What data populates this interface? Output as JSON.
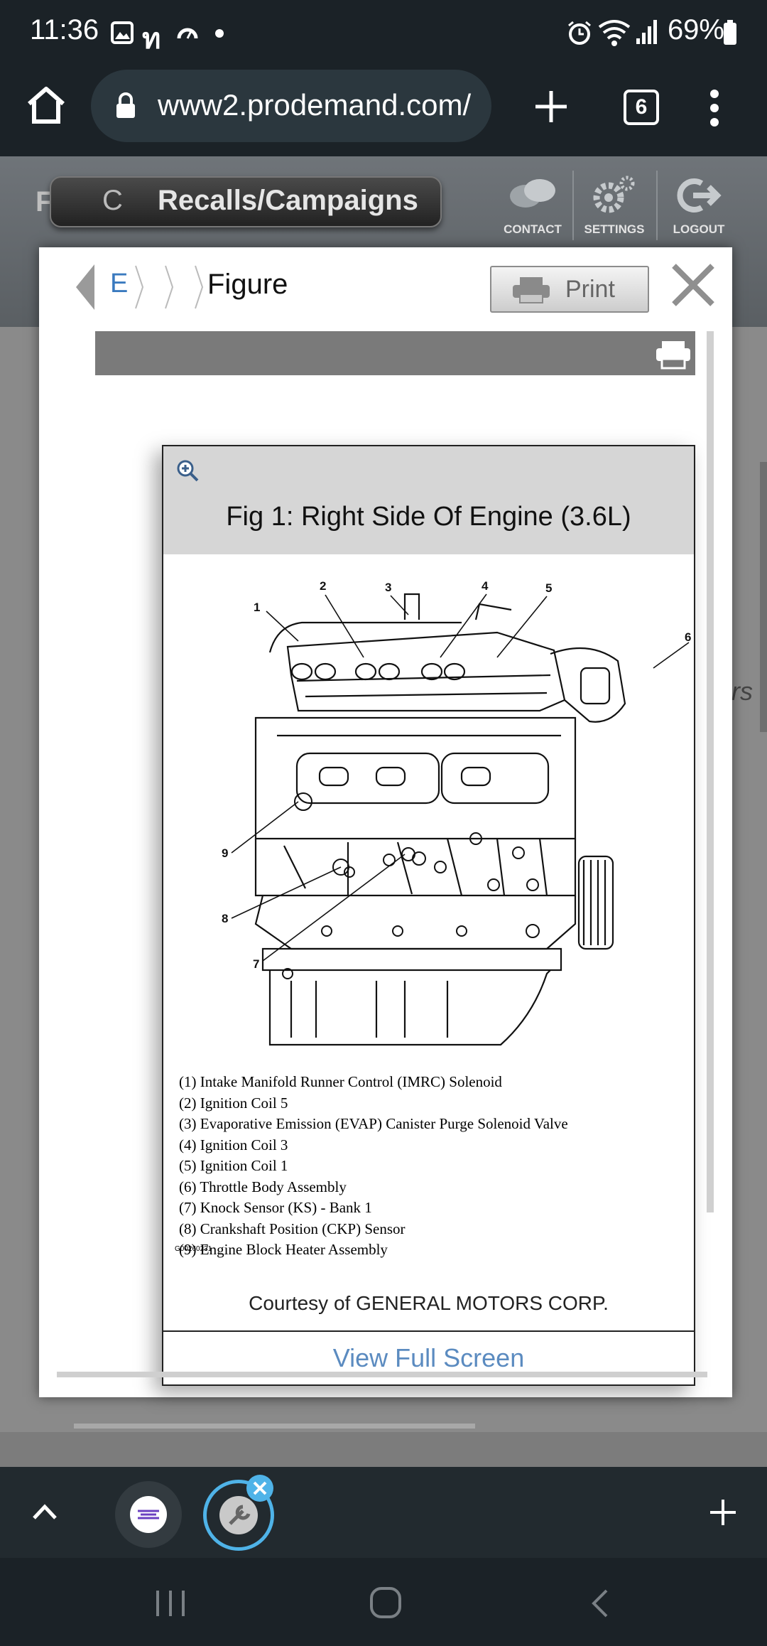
{
  "status_bar": {
    "time": "11:36",
    "battery": "69%",
    "icons": [
      "image-icon",
      "n-icon",
      "speedometer-icon",
      "dot-icon",
      "alarm-icon",
      "wifi-icon",
      "signal-icon",
      "battery-icon"
    ]
  },
  "browser": {
    "url": "www2.prodemand.com/",
    "tab_count": "6"
  },
  "site": {
    "recalls_prefix": "C",
    "recalls_label": "Recalls/Campaigns",
    "contact": "CONTACT",
    "settings": "SETTINGS",
    "logout": "LOGOUT",
    "left_letter": "F",
    "right_text": "rs"
  },
  "modal": {
    "breadcrumb_first": "E",
    "title": "Figure",
    "print_label": "Print",
    "figure": {
      "caption": "Fig 1: Right Side Of Engine (3.6L)",
      "callouts": [
        "1",
        "2",
        "3",
        "4",
        "5",
        "6",
        "7",
        "8",
        "9"
      ],
      "legend": [
        "(1) Intake Manifold Runner Control (IMRC) Solenoid",
        "(2) Ignition Coil 5",
        "(3) Evaporative Emission (EVAP) Canister Purge Solenoid Valve",
        "(4) Ignition Coil 3",
        "(5) Ignition Coil 1",
        "(6) Throttle Body Assembly",
        "(7) Knock Sensor (KS) - Bank 1",
        "(8) Crankshaft Position (CKP) Sensor",
        "(9) Engine Block Heater Assembly"
      ],
      "figure_id": "G00260231",
      "courtesy": "Courtesy of GENERAL MOTORS CORP.",
      "full_screen": "View Full Screen"
    }
  },
  "colors": {
    "status_bg": "#1b2227",
    "url_bg": "#2b373e",
    "link_blue": "#5b8bc0",
    "tab_ring": "#4fb3e8"
  }
}
